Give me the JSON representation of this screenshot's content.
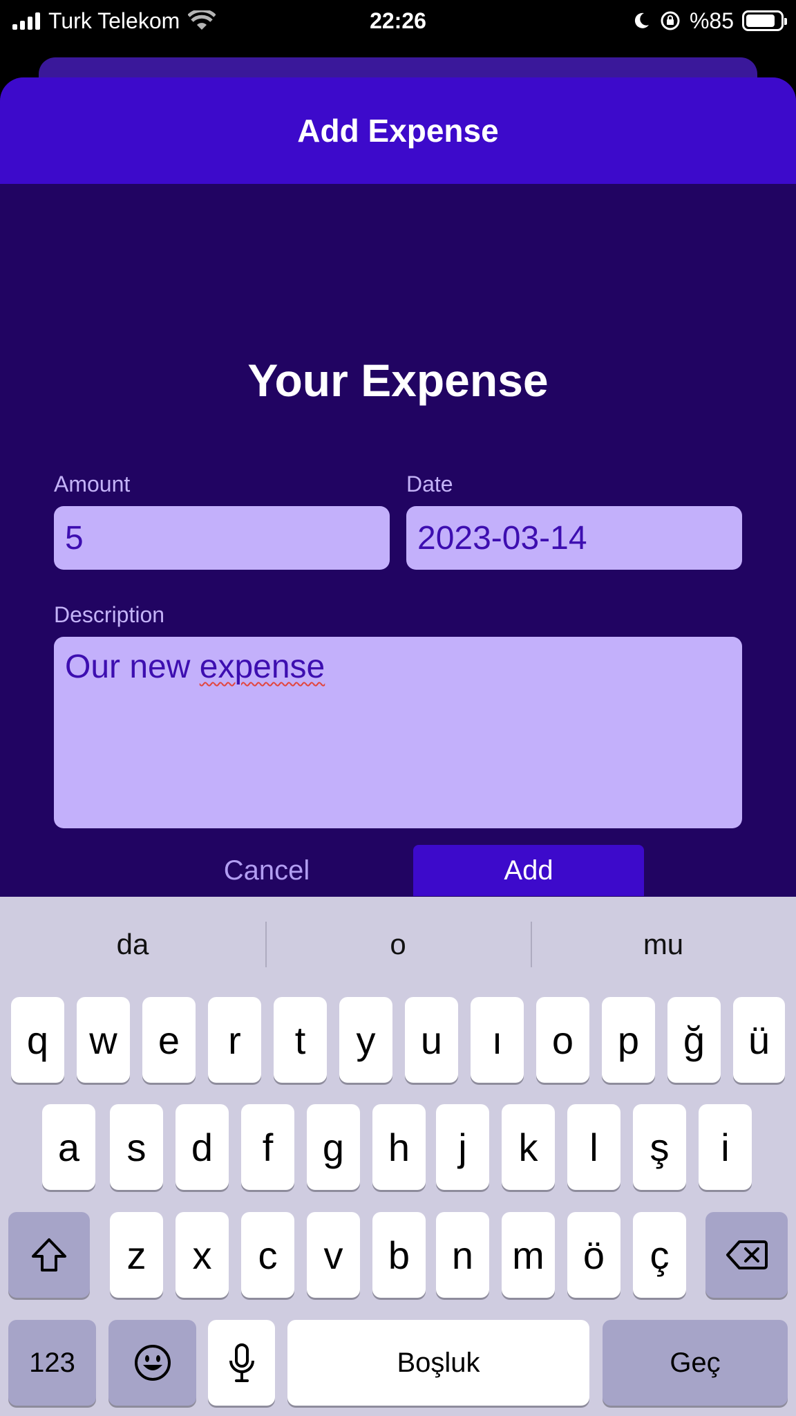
{
  "status_bar": {
    "carrier": "Turk Telekom",
    "time": "22:26",
    "battery": "%85"
  },
  "header": {
    "title": "Add Expense"
  },
  "form": {
    "title": "Your Expense",
    "amount_label": "Amount",
    "amount_value": "5",
    "date_label": "Date",
    "date_value": "2023-03-14",
    "description_label": "Description",
    "description_value_part1": "Our new ",
    "description_value_part2": "expense",
    "cancel_label": "Cancel",
    "add_label": "Add"
  },
  "keyboard": {
    "suggestions": [
      "da",
      "o",
      "mu"
    ],
    "row1": [
      "q",
      "w",
      "e",
      "r",
      "t",
      "y",
      "u",
      "ı",
      "o",
      "p",
      "ğ",
      "ü"
    ],
    "row2": [
      "a",
      "s",
      "d",
      "f",
      "g",
      "h",
      "j",
      "k",
      "l",
      "ş",
      "i"
    ],
    "row3": [
      "z",
      "x",
      "c",
      "v",
      "b",
      "n",
      "m",
      "ö",
      "ç"
    ],
    "numbers_label": "123",
    "space_label": "Boşluk",
    "return_label": "Geç"
  },
  "colors": {
    "sheet_background": "#210462",
    "header_background": "#3d0acb",
    "input_background": "#c3b0fb",
    "input_text": "#3d0eb0",
    "label_text": "#c4b3f7"
  },
  "icons": [
    "signal-icon",
    "wifi-icon",
    "moon-icon",
    "orientation-lock-icon",
    "battery-icon",
    "shift-icon",
    "backspace-icon",
    "emoji-icon",
    "microphone-icon"
  ]
}
